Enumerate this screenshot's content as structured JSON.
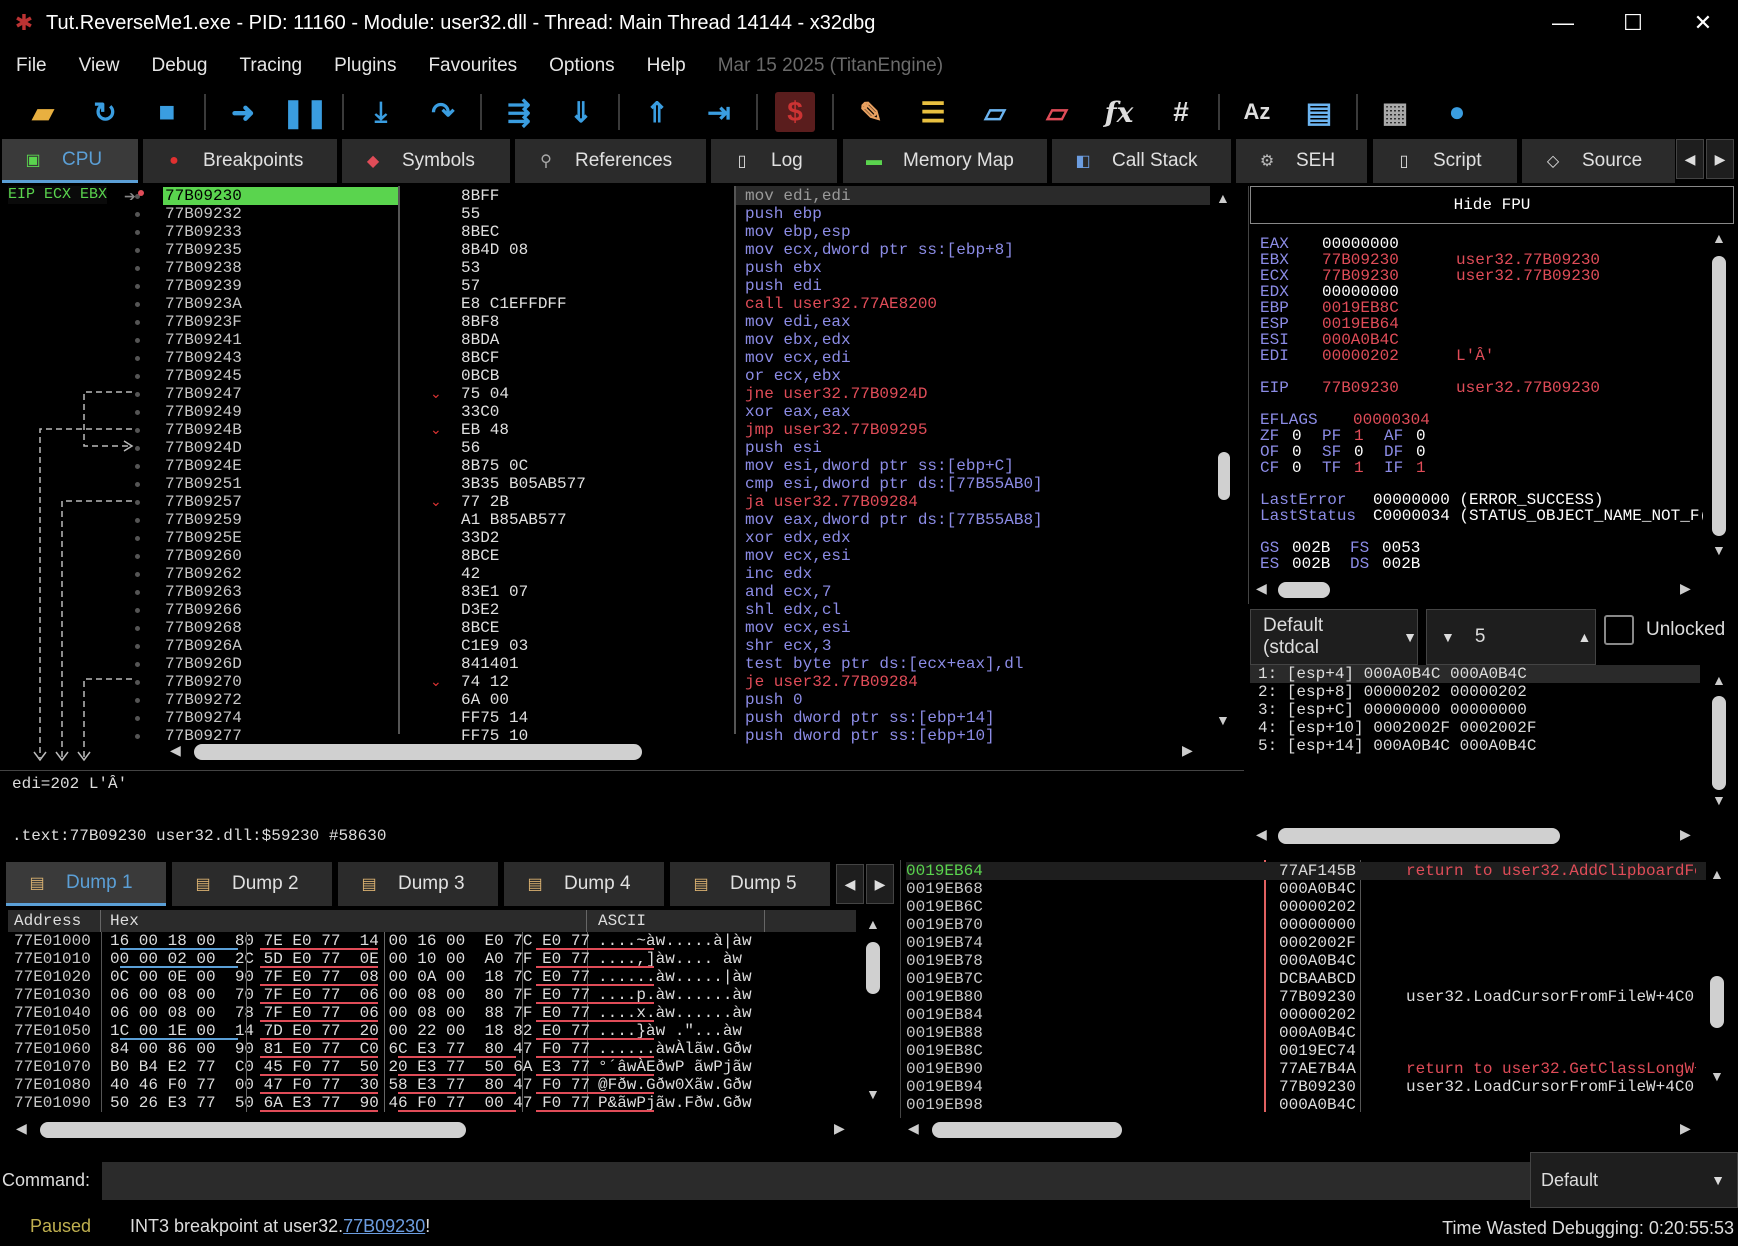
{
  "window": {
    "title": "Tut.ReverseMe1.exe - PID: 11160 - Module: user32.dll - Thread: Main Thread 14144 - x32dbg",
    "minimize": "—",
    "maximize": "☐",
    "close": "✕"
  },
  "menu": {
    "items": [
      "File",
      "View",
      "Debug",
      "Tracing",
      "Plugins",
      "Favourites",
      "Options",
      "Help"
    ],
    "date": "Mar 15 2025 (TitanEngine)"
  },
  "toolbar": {
    "icons": [
      "open-icon",
      "restart-icon",
      "stop-icon",
      "run-icon",
      "pause-icon",
      "step-into-icon",
      "step-over-icon",
      "trace-into-icon",
      "trace-over-icon",
      "execute-till-return-icon",
      "run-to-user-code-icon",
      "scylla-icon",
      "patch-icon",
      "comments-icon",
      "labels-icon",
      "bookmarks-icon",
      "functions-icon",
      "variables-icon",
      "strings-icon",
      "cpuid-icon",
      "calculator-icon",
      "website-icon"
    ],
    "glyphs": {
      "fx": "fx",
      "hash": "#",
      "az": "Aᴢ",
      "dollar": "$"
    }
  },
  "tabs": [
    {
      "label": "CPU",
      "icon": "cpu-icon"
    },
    {
      "label": "Breakpoints",
      "icon": "breakpoint-icon"
    },
    {
      "label": "Symbols",
      "icon": "symbols-icon"
    },
    {
      "label": "References",
      "icon": "references-icon"
    },
    {
      "label": "Log",
      "icon": "log-icon"
    },
    {
      "label": "Memory Map",
      "icon": "memory-map-icon"
    },
    {
      "label": "Call Stack",
      "icon": "call-stack-icon"
    },
    {
      "label": "SEH",
      "icon": "seh-icon"
    },
    {
      "label": "Script",
      "icon": "script-icon"
    },
    {
      "label": "Source",
      "icon": "source-icon"
    }
  ],
  "cpu": {
    "eip_labels": "EIP ECX EBX",
    "rows": [
      {
        "addr": "77B09230",
        "bytes": "8BFF",
        "instr": "mov edi,edi"
      },
      {
        "addr": "77B09232",
        "bytes": "55",
        "instr": "push ebp"
      },
      {
        "addr": "77B09233",
        "bytes": "8BEC",
        "instr": "mov ebp,esp"
      },
      {
        "addr": "77B09235",
        "bytes": "8B4D 08",
        "instr": "mov ecx,dword ptr ss:[ebp+8]"
      },
      {
        "addr": "77B09238",
        "bytes": "53",
        "instr": "push ebx"
      },
      {
        "addr": "77B09239",
        "bytes": "57",
        "instr": "push edi"
      },
      {
        "addr": "77B0923A",
        "bytes": "E8 C1EFFDFF",
        "instr": "call user32.77AE8200"
      },
      {
        "addr": "77B0923F",
        "bytes": "8BF8",
        "instr": "mov edi,eax"
      },
      {
        "addr": "77B09241",
        "bytes": "8BDA",
        "instr": "mov ebx,edx"
      },
      {
        "addr": "77B09243",
        "bytes": "8BCF",
        "instr": "mov ecx,edi"
      },
      {
        "addr": "77B09245",
        "bytes": "0BCB",
        "instr": "or ecx,ebx"
      },
      {
        "addr": "77B09247",
        "bytes": "75 04",
        "instr": "jne user32.77B0924D"
      },
      {
        "addr": "77B09249",
        "bytes": "33C0",
        "instr": "xor eax,eax"
      },
      {
        "addr": "77B0924B",
        "bytes": "EB 48",
        "instr": "jmp user32.77B09295"
      },
      {
        "addr": "77B0924D",
        "bytes": "56",
        "instr": "push esi"
      },
      {
        "addr": "77B0924E",
        "bytes": "8B75 0C",
        "instr": "mov esi,dword ptr ss:[ebp+C]"
      },
      {
        "addr": "77B09251",
        "bytes": "3B35 B05AB577",
        "instr": "cmp esi,dword ptr ds:[77B55AB0]"
      },
      {
        "addr": "77B09257",
        "bytes": "77 2B",
        "instr": "ja user32.77B09284"
      },
      {
        "addr": "77B09259",
        "bytes": "A1 B85AB577",
        "instr": "mov eax,dword ptr ds:[77B55AB8]"
      },
      {
        "addr": "77B0925E",
        "bytes": "33D2",
        "instr": "xor edx,edx"
      },
      {
        "addr": "77B09260",
        "bytes": "8BCE",
        "instr": "mov ecx,esi"
      },
      {
        "addr": "77B09262",
        "bytes": "42",
        "instr": "inc edx"
      },
      {
        "addr": "77B09263",
        "bytes": "83E1 07",
        "instr": "and ecx,7"
      },
      {
        "addr": "77B09266",
        "bytes": "D3E2",
        "instr": "shl edx,cl"
      },
      {
        "addr": "77B09268",
        "bytes": "8BCE",
        "instr": "mov ecx,esi"
      },
      {
        "addr": "77B0926A",
        "bytes": "C1E9 03",
        "instr": "shr ecx,3"
      },
      {
        "addr": "77B0926D",
        "bytes": "841401",
        "instr": "test byte ptr ds:[ecx+eax],dl"
      },
      {
        "addr": "77B09270",
        "bytes": "74 12",
        "instr": "je user32.77B09284"
      },
      {
        "addr": "77B09272",
        "bytes": "6A 00",
        "instr": "push 0"
      },
      {
        "addr": "77B09274",
        "bytes": "FF75 14",
        "instr": "push dword ptr ss:[ebp+14]"
      },
      {
        "addr": "77B09277",
        "bytes": "FF75 10",
        "instr": "push dword ptr ss:[ebp+10]"
      }
    ],
    "info_line1": "edi=202 L'Ȃ'",
    "info_line2": ".text:77B09230 user32.dll:$59230 #58630"
  },
  "registers": {
    "hide_fpu": "Hide FPU",
    "general": [
      {
        "name": "EAX",
        "value": "00000000",
        "comment": ""
      },
      {
        "name": "EBX",
        "value": "77B09230",
        "comment": "user32.77B09230"
      },
      {
        "name": "ECX",
        "value": "77B09230",
        "comment": "user32.77B09230"
      },
      {
        "name": "EDX",
        "value": "00000000",
        "comment": ""
      },
      {
        "name": "EBP",
        "value": "0019EB8C",
        "comment": ""
      },
      {
        "name": "ESP",
        "value": "0019EB64",
        "comment": ""
      },
      {
        "name": "ESI",
        "value": "000A0B4C",
        "comment": ""
      },
      {
        "name": "EDI",
        "value": "00000202",
        "comment": "L'Ȃ'"
      }
    ],
    "eip": {
      "name": "EIP",
      "value": "77B09230",
      "comment": "user32.77B09230"
    },
    "eflags": {
      "name": "EFLAGS",
      "value": "00000304"
    },
    "flags_rows": [
      [
        [
          "ZF",
          "0"
        ],
        [
          "PF",
          "1"
        ],
        [
          "AF",
          "0"
        ]
      ],
      [
        [
          "OF",
          "0"
        ],
        [
          "SF",
          "0"
        ],
        [
          "DF",
          "0"
        ]
      ],
      [
        [
          "CF",
          "0"
        ],
        [
          "TF",
          "1"
        ],
        [
          "IF",
          "1"
        ]
      ]
    ],
    "last_error_label": "LastError",
    "last_error": "00000000 (ERROR_SUCCESS)",
    "last_status_label": "LastStatus",
    "last_status": "C0000034 (STATUS_OBJECT_NAME_NOT_F(",
    "segments": [
      [
        [
          "GS",
          "002B"
        ],
        [
          "FS",
          "0053"
        ]
      ],
      [
        [
          "ES",
          "002B"
        ],
        [
          "DS",
          "002B"
        ]
      ]
    ]
  },
  "args": {
    "callconv": "Default (stdcal",
    "count": "5",
    "unlocked": "Unlocked",
    "rows": [
      "1: [esp+4] 000A0B4C 000A0B4C",
      "2: [esp+8] 00000202 00000202",
      "3: [esp+C] 00000000 00000000",
      "4: [esp+10] 0002002F 0002002F",
      "5: [esp+14] 000A0B4C 000A0B4C"
    ]
  },
  "dump": {
    "tabs": [
      "Dump 1",
      "Dump 2",
      "Dump 3",
      "Dump 4",
      "Dump 5"
    ],
    "headers": {
      "address": "Address",
      "hex": "Hex",
      "ascii": "ASCII"
    },
    "rows": [
      {
        "addr": "77E01000",
        "hex": "16 00 18 00  80 7E E0 77  14 00 16 00  E0 7C E0 77",
        "ascii": "....~àw.....à|àw"
      },
      {
        "addr": "77E01010",
        "hex": "00 00 02 00  2C 5D E0 77  0E 00 10 00  A0 7F E0 77",
        "ascii": "....,]àw.... àw"
      },
      {
        "addr": "77E01020",
        "hex": "0C 00 0E 00  90 7F E0 77  08 00 0A 00  18 7C E0 77",
        "ascii": "......àw.....|àw"
      },
      {
        "addr": "77E01030",
        "hex": "06 00 08 00  70 7F E0 77  06 00 08 00  80 7F E0 77",
        "ascii": "....p.àw......àw"
      },
      {
        "addr": "77E01040",
        "hex": "06 00 08 00  78 7F E0 77  06 00 08 00  88 7F E0 77",
        "ascii": "....x.àw......àw"
      },
      {
        "addr": "77E01050",
        "hex": "1C 00 1E 00  14 7D E0 77  20 00 22 00  18 82 E0 77",
        "ascii": "....}àw .\"...àw"
      },
      {
        "addr": "77E01060",
        "hex": "84 00 86 00  90 81 E0 77  C0 6C E3 77  80 47 F0 77",
        "ascii": "......àwÀlãw.Gðw"
      },
      {
        "addr": "77E01070",
        "hex": "B0 B4 E2 77  C0 45 F0 77  50 20 E3 77  50 6A E3 77",
        "ascii": "°´âwÀEðwP ãwPjãw"
      },
      {
        "addr": "77E01080",
        "hex": "40 46 F0 77  00 47 F0 77  30 58 E3 77  80 47 F0 77",
        "ascii": "@Fðw.Gðw0Xãw.Gðw"
      },
      {
        "addr": "77E01090",
        "hex": "50 26 E3 77  50 6A E3 77  90 46 F0 77  00 47 F0 77",
        "ascii": "P&ãwPjãw.Fðw.Gðw"
      }
    ]
  },
  "stack": {
    "rows": [
      {
        "addr": "0019EB64",
        "value": "77AF145B",
        "comment": "return to user32.AddClipboardFo",
        "ret": true
      },
      {
        "addr": "0019EB68",
        "value": "000A0B4C",
        "comment": "",
        "ret": false
      },
      {
        "addr": "0019EB6C",
        "value": "00000202",
        "comment": "",
        "ret": false
      },
      {
        "addr": "0019EB70",
        "value": "00000000",
        "comment": "",
        "ret": false
      },
      {
        "addr": "0019EB74",
        "value": "0002002F",
        "comment": "",
        "ret": false
      },
      {
        "addr": "0019EB78",
        "value": "000A0B4C",
        "comment": "",
        "ret": false
      },
      {
        "addr": "0019EB7C",
        "value": "DCBAABCD",
        "comment": "",
        "ret": false
      },
      {
        "addr": "0019EB80",
        "value": "77B09230",
        "comment": "user32.LoadCursorFromFileW+4C0",
        "ret": false
      },
      {
        "addr": "0019EB84",
        "value": "00000202",
        "comment": "",
        "ret": false
      },
      {
        "addr": "0019EB88",
        "value": "000A0B4C",
        "comment": "",
        "ret": false
      },
      {
        "addr": "0019EB8C",
        "value": "0019EC74",
        "comment": "",
        "ret": false
      },
      {
        "addr": "0019EB90",
        "value": "77AE7B4A",
        "comment": "return to user32.GetClassLongW+",
        "ret": true
      },
      {
        "addr": "0019EB94",
        "value": "77B09230",
        "comment": "user32.LoadCursorFromFileW+4C0",
        "ret": false
      },
      {
        "addr": "0019EB98",
        "value": "000A0B4C",
        "comment": "",
        "ret": false
      }
    ]
  },
  "command": {
    "label": "Command:",
    "input": "",
    "selector": "Default"
  },
  "status": {
    "state": "Paused",
    "message_prefix": "INT3 breakpoint at user32.",
    "message_link": "77B09230",
    "message_suffix": "!",
    "time_wasted": "Time Wasted Debugging: 0:20:55:53"
  },
  "colors": {
    "eip_green": "#5ad44e",
    "keyword_blue": "#8c8ce6",
    "call_red": "#e04c58",
    "accent": "#5b9fd6",
    "paused": "#c0b050"
  }
}
